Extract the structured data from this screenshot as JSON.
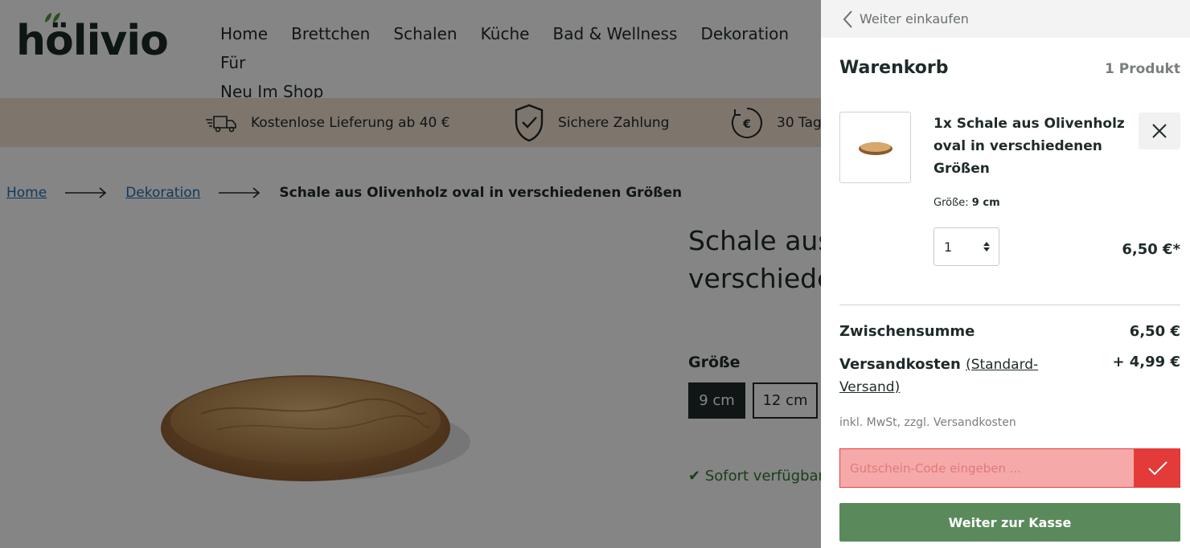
{
  "header": {
    "logo_text": "hölivio",
    "nav": [
      "Home",
      "Brettchen",
      "Schalen",
      "Küche",
      "Bad & Wellness",
      "Dekoration",
      "Für",
      "Neu Im Shop"
    ]
  },
  "usp": {
    "delivery": "Kostenlose Lieferung ab 40 €",
    "payment": "Sichere Zahlung",
    "returns": "30 Tag"
  },
  "breadcrumb": {
    "home": "Home",
    "category": "Dekoration",
    "current": "Schale aus Olivenholz oval in verschiedenen Größen"
  },
  "product": {
    "title_line1": "Schale aus",
    "title_line2": "verschieder",
    "size_label": "Größe",
    "sizes": [
      "9 cm",
      "12 cm"
    ],
    "availability": "Sofort verfügbar,"
  },
  "cart": {
    "back_label": "Weiter einkaufen",
    "title": "Warenkorb",
    "count": "1 Produkt",
    "item": {
      "name": "1x Schale aus Olivenholz oval in verschiedenen Größen",
      "size_label": "Größe:",
      "size_value": "9 cm",
      "quantity": "1",
      "price": "6,50 €*"
    },
    "subtotal_label": "Zwischensumme",
    "subtotal_value": "6,50 €",
    "shipping_label": "Versandkosten",
    "shipping_link": "(Standard-Versand)",
    "shipping_value": "+ 4,99 €",
    "tax_note": "inkl. MwSt, zzgl. Versandkosten",
    "voucher_placeholder": "Gutschein-Code eingeben ...",
    "checkout_label": "Weiter zur Kasse"
  },
  "colors": {
    "usp_bar": "#f1e1d1",
    "checkout_green": "#5a8a5c",
    "voucher_red": "#e33a3a",
    "link_blue": "#1f6fb2"
  }
}
